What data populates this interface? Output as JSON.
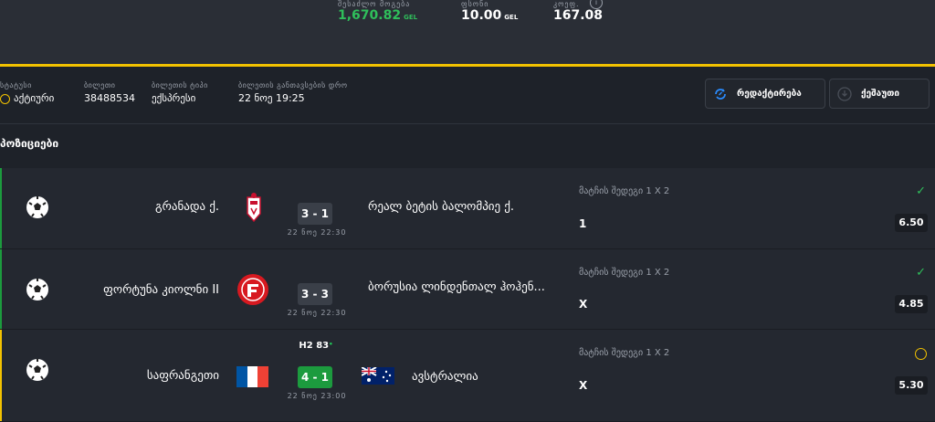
{
  "summary": {
    "possible_win_label": "შესაძლო მოგება",
    "possible_win_value": "1,670.82",
    "currency": "GEL",
    "stake_label": "ფსონი",
    "stake_value": "10.00",
    "odds_label": "კოეფ.",
    "odds_value": "167.08",
    "info_icon": "i"
  },
  "ticket": {
    "status_label": "სტატუსი",
    "status_value": "აქტიური",
    "ticket_label": "ბილეთი",
    "ticket_value": "38488534",
    "type_label": "ბილეთის ტიპი",
    "type_value": "ექსპრესი",
    "date_label": "ბილეთის განთავსების დრო",
    "date_value": "22 ნოე 19:25"
  },
  "actions": {
    "edit_label": "რედაქტირება",
    "cashout_label": "ქეშაუთი"
  },
  "section_title": "პოზიციები",
  "colors": {
    "accent": "#f2c200",
    "win": "#2fbf5b",
    "live": "#1c9b3e"
  },
  "positions": [
    {
      "home": "გრანადა ქ.",
      "away": "რეალ ბეტის ბალომპიე ქ.",
      "score": "3 - 1",
      "datetime": "22 ნოე 22:30",
      "market": "მატჩის შედეგი 1 X 2",
      "pick": "1",
      "odds": "6.50",
      "state": "won"
    },
    {
      "home": "ფორტუნა კიოლნი II",
      "away": "ბორუსია ლინდენთალ ჰოჰენ...",
      "score": "3 - 3",
      "datetime": "22 ნოე 22:30",
      "market": "მატჩის შედეგი 1 X 2",
      "pick": "X",
      "odds": "4.85",
      "state": "won"
    },
    {
      "home": "საფრანგეთი",
      "away": "ავსტრალია",
      "score": "4 - 1",
      "live_time": "H2 83",
      "datetime": "22 ნოე 23:00",
      "market": "მატჩის შედეგი 1 X 2",
      "pick": "X",
      "odds": "5.30",
      "state": "pending"
    }
  ]
}
